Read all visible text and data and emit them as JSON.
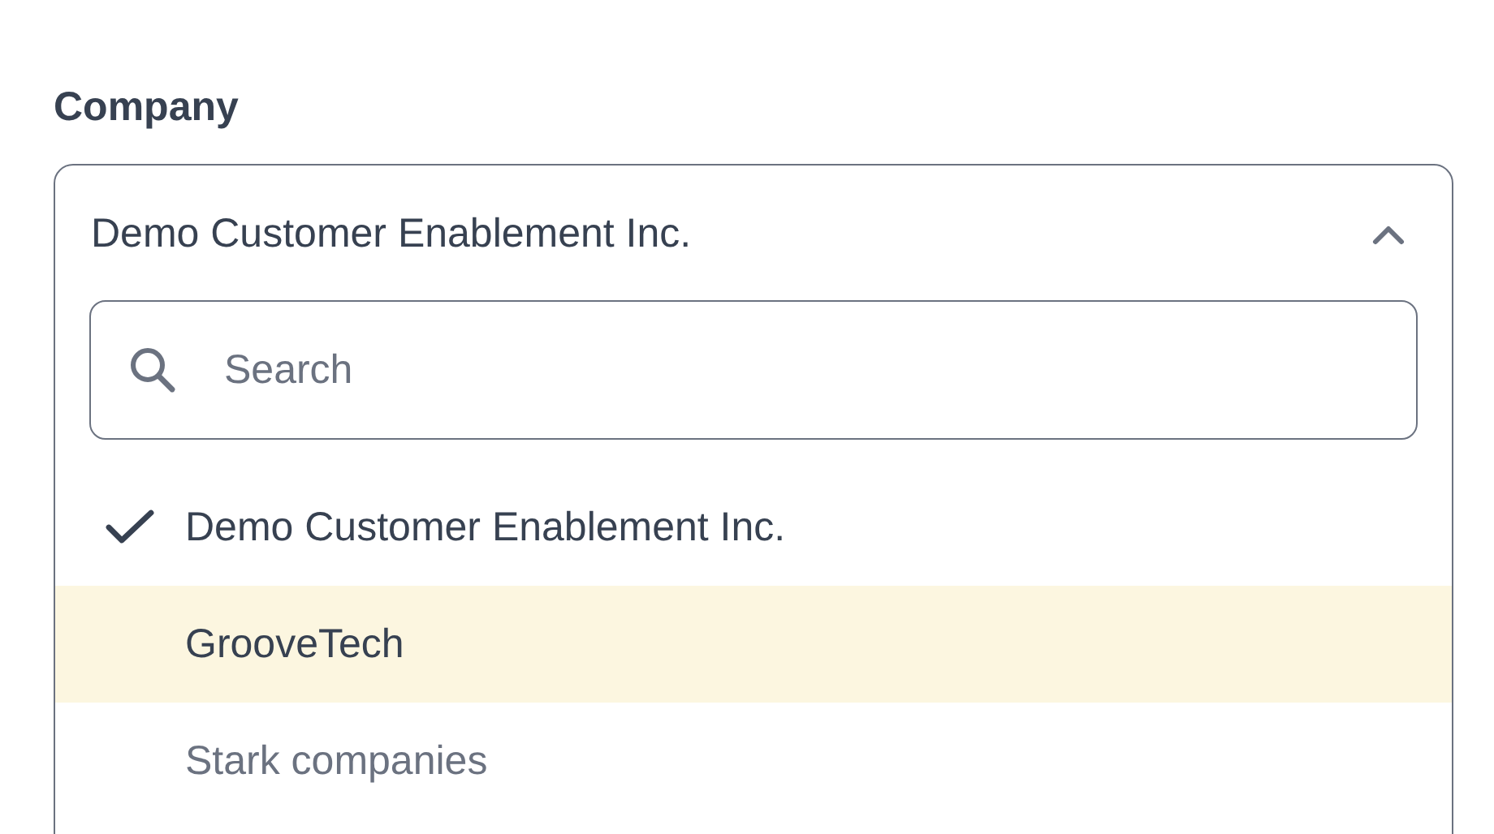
{
  "field": {
    "label": "Company",
    "value": "Demo Customer Enablement Inc.",
    "expanded": true
  },
  "search": {
    "placeholder": "Search"
  },
  "options": [
    {
      "label": "Demo Customer Enablement Inc.",
      "selected": true,
      "highlighted": false,
      "disabled": false
    },
    {
      "label": "GrooveTech",
      "selected": false,
      "highlighted": true,
      "disabled": false
    },
    {
      "label": "Stark companies",
      "selected": false,
      "highlighted": false,
      "disabled": true
    }
  ]
}
